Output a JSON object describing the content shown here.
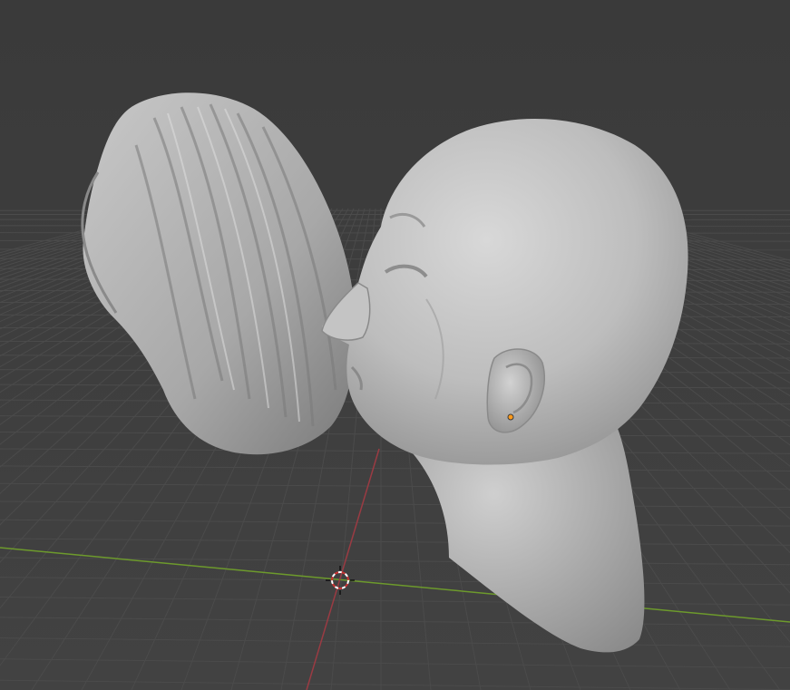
{
  "viewport": {
    "colors": {
      "background_top": "#3a3a3a",
      "background_bottom": "#414141",
      "grid_line": "#4a4a4a",
      "x_axis": "#9a3b43",
      "y_axis": "#6d9a2c",
      "mesh_base": "#b9b9b9",
      "mesh_highlight": "#d6d6d6",
      "mesh_shadow": "#6a6a6a",
      "origin_dot": "#ff9a1a",
      "cursor_red": "#cc3333",
      "cursor_white": "#ffffff"
    },
    "objects": [
      {
        "name": "hair-mesh-icon",
        "label": ""
      },
      {
        "name": "head-mesh-icon",
        "label": ""
      }
    ]
  }
}
